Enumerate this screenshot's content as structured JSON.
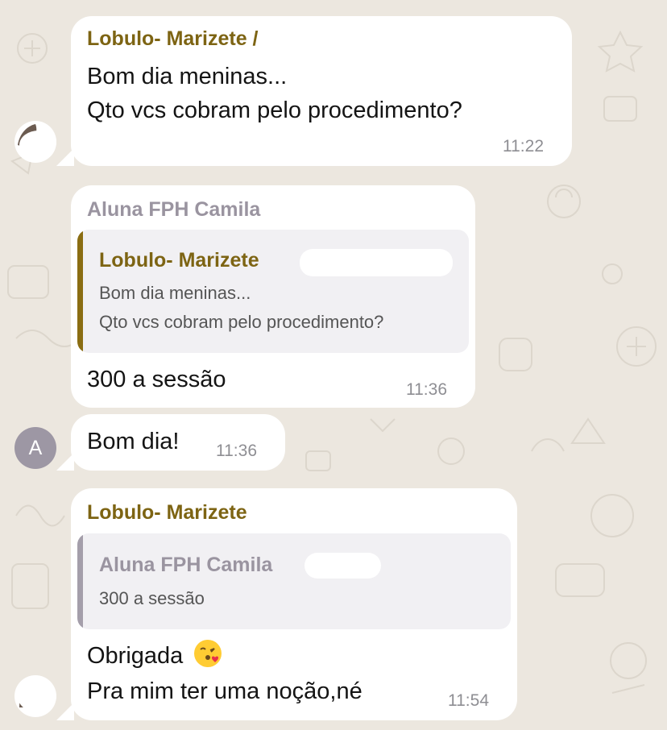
{
  "messages": [
    {
      "sender": "Lobulo- Marizete /",
      "lines": [
        "Bom dia meninas...",
        "Qto vcs cobram pelo procedimento?"
      ],
      "time": "11:22"
    },
    {
      "sender": "Aluna FPH Camila",
      "quote": {
        "sender": "Lobulo- Marizete",
        "lines": [
          "Bom dia meninas...",
          "Qto vcs cobram pelo procedimento?"
        ]
      },
      "text": "300 a sessão",
      "time": "11:36"
    },
    {
      "avatar_letter": "A",
      "text": "Bom dia!",
      "time": "11:36"
    },
    {
      "sender": "Lobulo- Marizete",
      "quote": {
        "sender": "Aluna FPH Camila",
        "text": "300 a sessão"
      },
      "lines": [
        "Obrigada",
        "Pra mim ter uma noção,né"
      ],
      "emoji": "kissing-face-with-heart-emoji",
      "time": "11:54"
    }
  ],
  "colors": {
    "background": "#ece7df",
    "sender_gold": "#7d6413",
    "sender_gray": "#9a94a0",
    "quote_bar_gold": "#8a6d12",
    "quote_bar_gray": "#a49eaa",
    "avatar_gray": "#9d97a4"
  }
}
